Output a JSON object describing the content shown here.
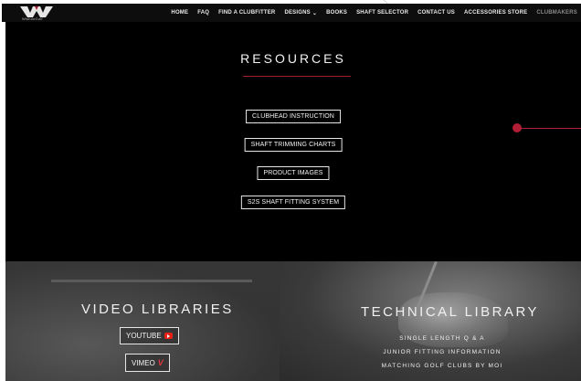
{
  "nav": {
    "logo_text": "WishonGolf",
    "items": [
      {
        "label": "HOME"
      },
      {
        "label": "FAQ"
      },
      {
        "label": "FIND A CLUBFITTER"
      },
      {
        "label": "DESIGNS",
        "dropdown": true
      },
      {
        "label": "BOOKS"
      },
      {
        "label": "SHAFT SELECTOR"
      },
      {
        "label": "CONTACT US"
      },
      {
        "label": "ACCESSORIES STORE"
      },
      {
        "label": "CLUBMAKERS"
      }
    ],
    "dropdown_chevron": "⌄"
  },
  "resources": {
    "title": "RESOURCES",
    "buttons": [
      {
        "label": "CLUBHEAD INSTRUCTION"
      },
      {
        "label": "SHAFT TRIMMING CHARTS"
      },
      {
        "label": "PRODUCT IMAGES"
      },
      {
        "label": "S2S SHAFT FITTING SYSTEM"
      }
    ]
  },
  "video": {
    "title": "VIDEO LIBRARIES",
    "youtube_label": "YOUTUBE",
    "vimeo_label": "VIMEO",
    "vimeo_glyph": "V"
  },
  "technical": {
    "title": "TECHNICAL LIBRARY",
    "links": [
      {
        "label": "SINGLE LENGTH Q & A"
      },
      {
        "label": "JUNIOR FITTING INFORMATION"
      },
      {
        "label": "MATCHING GOLF CLUBS BY MOI"
      }
    ]
  },
  "colors": {
    "accent_red": "#b31e37",
    "youtube_red": "#e62117",
    "vimeo_red": "#e3343d"
  }
}
